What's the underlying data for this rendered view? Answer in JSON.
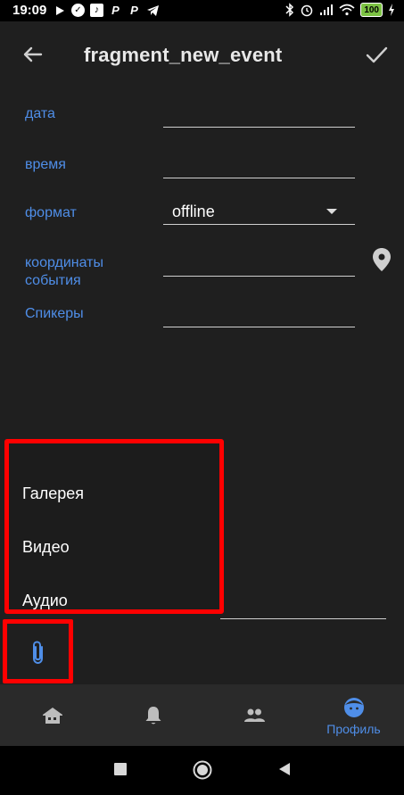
{
  "status_bar": {
    "time": "19:09",
    "left_icons": [
      "play-icon",
      "check-circle-icon",
      "music-icon",
      "p-icon",
      "p-icon",
      "telegram-icon"
    ],
    "battery_level": "100"
  },
  "toolbar": {
    "title": "fragment_new_event"
  },
  "form": {
    "date_label": "дата",
    "time_label": "время",
    "format_label": "формат",
    "format_value": "offline",
    "coords_label_line1": "координаты",
    "coords_label_line2": "события",
    "speakers_label": "Спикеры"
  },
  "attach_menu": {
    "items": [
      "Галерея",
      "Видео",
      "Аудио"
    ]
  },
  "bottom_nav": {
    "items": [
      {
        "icon": "home-icon",
        "label": ""
      },
      {
        "icon": "bell-icon",
        "label": ""
      },
      {
        "icon": "people-icon",
        "label": ""
      },
      {
        "icon": "profile-face-icon",
        "label": "Профиль"
      }
    ],
    "active_color": "#4f8ee8"
  },
  "colors": {
    "accent": "#4f8ee8",
    "highlight": "#ff0000",
    "background": "#1f1f1f"
  }
}
